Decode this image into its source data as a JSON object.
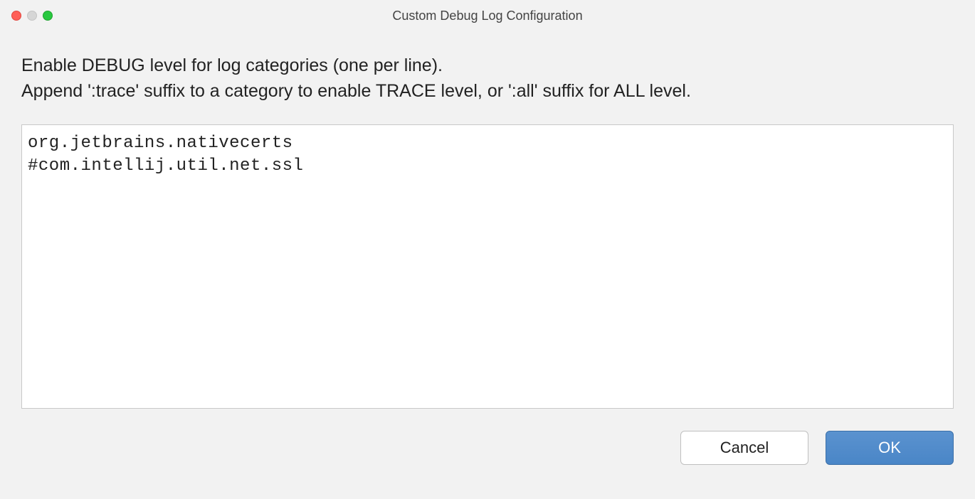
{
  "window": {
    "title": "Custom Debug Log Configuration"
  },
  "instructions": {
    "line1": "Enable DEBUG level for log categories (one per line).",
    "line2": "Append ':trace' suffix to a category to enable TRACE level, or ':all' suffix for ALL level."
  },
  "textarea": {
    "value": "org.jetbrains.nativecerts\n#com.intellij.util.net.ssl"
  },
  "buttons": {
    "cancel": "Cancel",
    "ok": "OK"
  }
}
